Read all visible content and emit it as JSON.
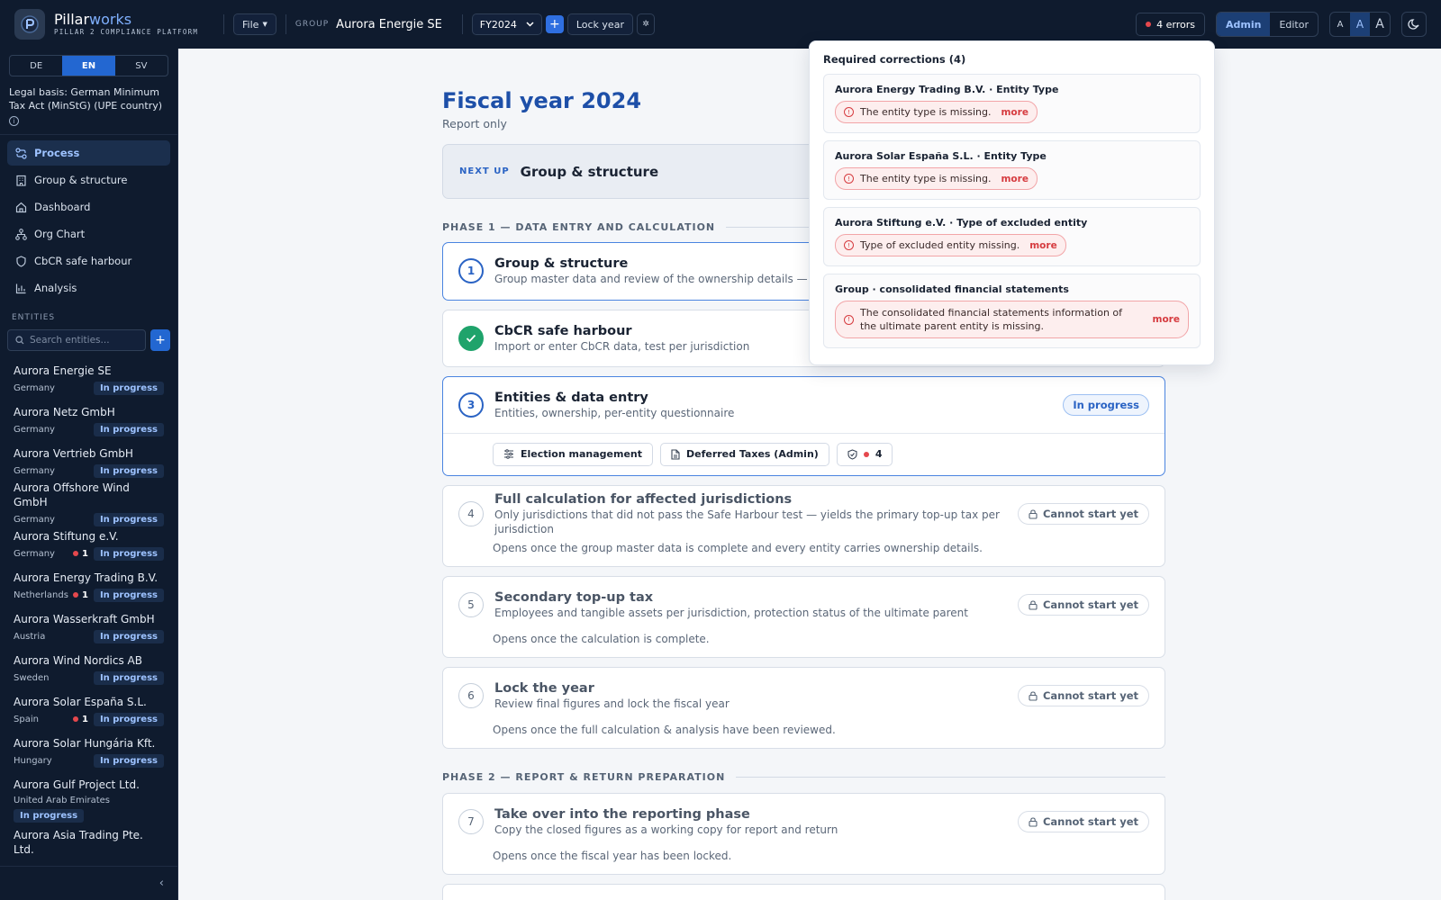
{
  "app": {
    "name_main": "Pillar",
    "name_accent": "works",
    "tagline": "PILLAR 2 COMPLIANCE PLATFORM",
    "file_menu": "File",
    "group_label": "GROUP",
    "group_name": "Aurora Energie SE",
    "fiscal_year": "FY2024",
    "add_year": "+",
    "lock_year": "Lock year",
    "errors_label": "4 errors",
    "roles": [
      "Admin",
      "Editor"
    ],
    "font_sizes": [
      "A",
      "A",
      "A"
    ]
  },
  "sidebar": {
    "languages": [
      "DE",
      "EN",
      "SV"
    ],
    "legal_basis": "Legal basis: German Minimum Tax Act (MinStG) (UPE country)",
    "nav": [
      {
        "label": "Process",
        "icon": "workflow-icon"
      },
      {
        "label": "Group & structure",
        "icon": "building-icon"
      },
      {
        "label": "Dashboard",
        "icon": "home-icon"
      },
      {
        "label": "Org Chart",
        "icon": "org-chart-icon"
      },
      {
        "label": "CbCR safe harbour",
        "icon": "shield-icon"
      },
      {
        "label": "Analysis",
        "icon": "bar-chart-icon"
      }
    ],
    "entities_heading": "ENTITIES",
    "search_placeholder": "Search entities...",
    "entities": [
      {
        "name": "Aurora Energie SE",
        "country": "Germany",
        "status": "In progress",
        "errors": ""
      },
      {
        "name": "Aurora Netz GmbH",
        "country": "Germany",
        "status": "In progress",
        "errors": ""
      },
      {
        "name": "Aurora Vertrieb GmbH",
        "country": "Germany",
        "status": "In progress",
        "errors": ""
      },
      {
        "name": "Aurora Offshore Wind GmbH",
        "country": "Germany",
        "status": "In progress",
        "errors": ""
      },
      {
        "name": "Aurora Stiftung e.V.",
        "country": "Germany",
        "status": "In progress",
        "errors": "1"
      },
      {
        "name": "Aurora Energy Trading B.V.",
        "country": "Netherlands",
        "status": "In progress",
        "errors": "1"
      },
      {
        "name": "Aurora Wasserkraft GmbH",
        "country": "Austria",
        "status": "In progress",
        "errors": ""
      },
      {
        "name": "Aurora Wind Nordics AB",
        "country": "Sweden",
        "status": "In progress",
        "errors": ""
      },
      {
        "name": "Aurora Solar España S.L.",
        "country": "Spain",
        "status": "In progress",
        "errors": "1"
      },
      {
        "name": "Aurora Solar Hungária Kft.",
        "country": "Hungary",
        "status": "In progress",
        "errors": ""
      },
      {
        "name": "Aurora Gulf Project Ltd.",
        "country": "United Arab Emirates",
        "status": "In progress",
        "errors": ""
      },
      {
        "name": "Aurora Asia Trading Pte. Ltd.",
        "country": "",
        "status": "",
        "errors": ""
      }
    ],
    "collapse": "‹"
  },
  "main": {
    "title": "Fiscal year 2024",
    "subtitle": "Report only",
    "next_up_label": "NEXT UP",
    "next_up_value": "Group & structure",
    "phase1": "PHASE 1 — DATA ENTRY AND CALCULATION",
    "phase2": "PHASE 2 — REPORT & RETURN PREPARATION",
    "steps": [
      {
        "n": "1",
        "title": "Group & structure",
        "desc": "Group master data and review of the ownership details — valid"
      },
      {
        "n": "2",
        "title": "CbCR safe harbour",
        "desc": "Import or enter CbCR data, test per jurisdiction"
      },
      {
        "n": "3",
        "title": "Entities & data entry",
        "desc": "Entities, ownership, per-entity questionnaire",
        "status": "In progress",
        "actions": [
          "Election management",
          "Deferred Taxes (Admin)",
          "4"
        ]
      },
      {
        "n": "4",
        "title": "Full calculation for affected jurisdictions",
        "desc": "Only jurisdictions that did not pass the Safe Harbour test — yields the primary top-up tax per jurisdiction",
        "status": "Cannot start yet",
        "note": "Opens once the group master data is complete and every entity carries ownership details."
      },
      {
        "n": "5",
        "title": "Secondary top-up tax",
        "desc": "Employees and tangible assets per jurisdiction, protection status of the ultimate parent",
        "status": "Cannot start yet",
        "note": "Opens once the calculation is complete."
      },
      {
        "n": "6",
        "title": "Lock the year",
        "desc": "Review final figures and lock the fiscal year",
        "status": "Cannot start yet",
        "note": "Opens once the full calculation & analysis have been reviewed."
      },
      {
        "n": "7",
        "title": "Take over into the reporting phase",
        "desc": "Copy the closed figures as a working copy for report and return",
        "status": "Cannot start yet",
        "note": "Opens once the fiscal year has been locked."
      }
    ]
  },
  "corrections": {
    "title": "Required corrections (4)",
    "more": "more",
    "items": [
      {
        "title": "Aurora Energy Trading B.V. · Entity Type",
        "msg": "The entity type is missing."
      },
      {
        "title": "Aurora Solar España S.L. · Entity Type",
        "msg": "The entity type is missing."
      },
      {
        "title": "Aurora Stiftung e.V. · Type of excluded entity",
        "msg": "Type of excluded entity missing."
      },
      {
        "title": "Group · consolidated financial statements",
        "msg": "The consolidated financial statements information of the ultimate parent entity is missing."
      }
    ]
  },
  "colors": {
    "topbar": "#0f1b2e",
    "accent": "#2367d1",
    "error": "#e5484d",
    "success": "#1fa36b"
  }
}
